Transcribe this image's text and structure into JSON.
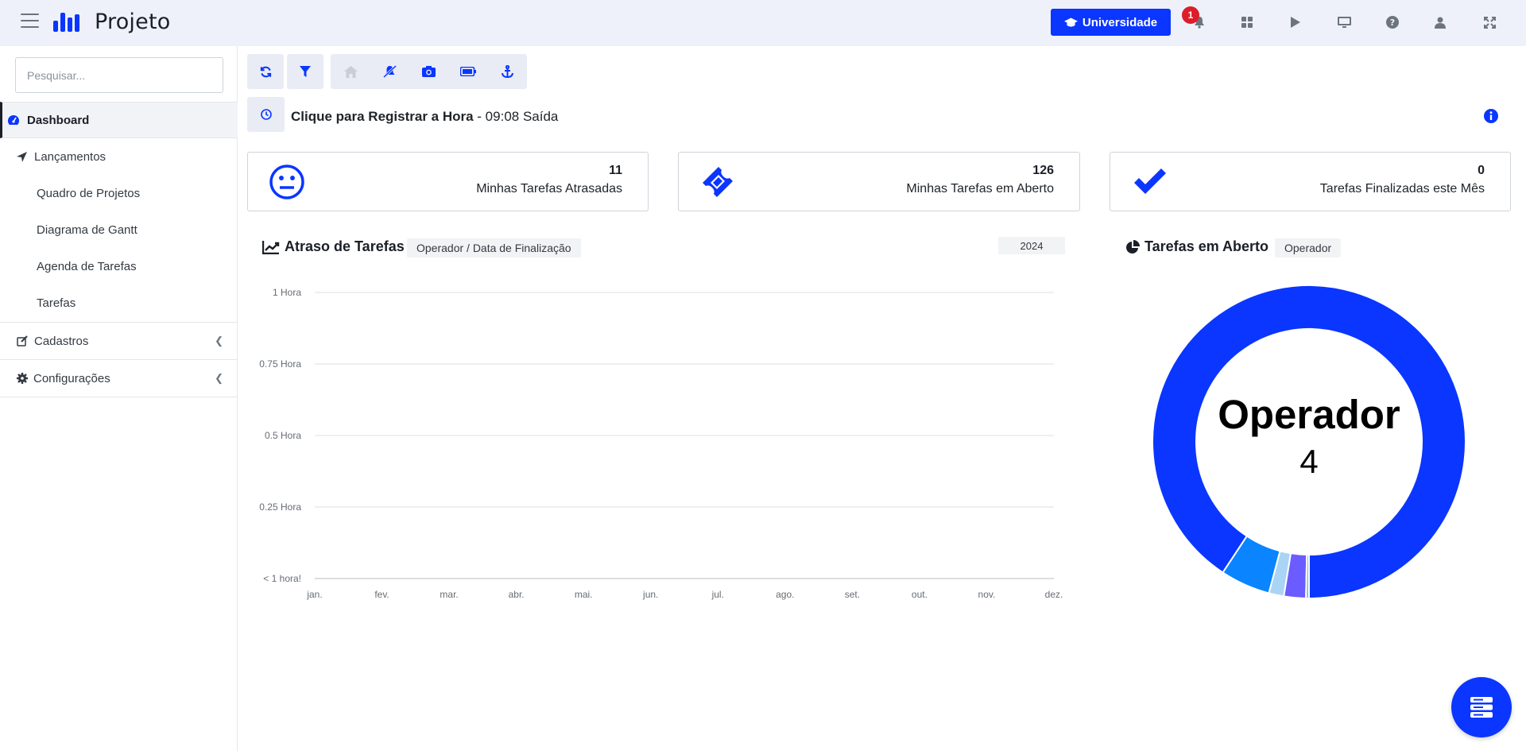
{
  "app": {
    "name": "Projeto"
  },
  "header": {
    "university_label": "Universidade",
    "notification_count": "1",
    "icons": [
      "bell-icon",
      "grid-icon",
      "play-icon",
      "monitor-icon",
      "help-icon",
      "user-icon",
      "fullscreen-icon"
    ]
  },
  "sidebar": {
    "search_placeholder": "Pesquisar...",
    "items": [
      {
        "label": "Dashboard",
        "icon": "gauge-icon",
        "active": true
      },
      {
        "label": "Lançamentos",
        "icon": "location-arrow-icon"
      },
      {
        "label": "Quadro de Projetos"
      },
      {
        "label": "Diagrama de Gantt"
      },
      {
        "label": "Agenda de Tarefas"
      },
      {
        "label": "Tarefas"
      },
      {
        "label": "Cadastros",
        "icon": "edit-icon"
      },
      {
        "label": "Configurações",
        "icon": "gear-icon"
      }
    ]
  },
  "toolbar": {
    "icons": [
      "refresh-icon",
      "filter-icon",
      "home-icon",
      "bell-slash-icon",
      "camera-icon",
      "battery-icon",
      "anchor-icon"
    ]
  },
  "clock": {
    "bold_text": "Clique para Registrar a Hora",
    "rest_text": " - 09:08 Saída"
  },
  "cards": [
    {
      "value": "11",
      "label": "Minhas Tarefas Atrasadas",
      "icon": "neutral-face-icon"
    },
    {
      "value": "126",
      "label": "Minhas Tarefas em Aberto",
      "icon": "ticket-icon"
    },
    {
      "value": "0",
      "label": "Tarefas Finalizadas este Mês",
      "icon": "check-icon"
    }
  ],
  "delay_chart": {
    "title": "Atraso de Tarefas",
    "chip": "Operador / Data de Finalização",
    "year": "2024"
  },
  "open_chart": {
    "title": "Tarefas em Aberto",
    "chip": "Operador",
    "center_title": "Operador",
    "center_value": "4"
  },
  "colors": {
    "primary": "#0a36ff",
    "donut_segments": [
      "#0a36ff",
      "#0a85ff",
      "#a9d4f5",
      "#6b5cff",
      "#7fb8f0"
    ]
  },
  "chart_data": [
    {
      "type": "line",
      "title": "Atraso de Tarefas",
      "categories": [
        "jan.",
        "fev.",
        "mar.",
        "abr.",
        "mai.",
        "jun.",
        "jul.",
        "ago.",
        "set.",
        "out.",
        "nov.",
        "dez."
      ],
      "y_ticks": [
        "1 Hora",
        "0.75 Hora",
        "0.5 Hora",
        "0.25 Hora",
        "< 1 hora!"
      ],
      "series": [],
      "ylim": [
        0,
        1
      ],
      "grid": true
    },
    {
      "type": "pie",
      "title": "Tarefas em Aberto",
      "slices": [
        {
          "value": 0.88
        },
        {
          "value": 0.05
        },
        {
          "value": 0.015
        },
        {
          "value": 0.022
        },
        {
          "value": 0.003
        }
      ]
    }
  ]
}
